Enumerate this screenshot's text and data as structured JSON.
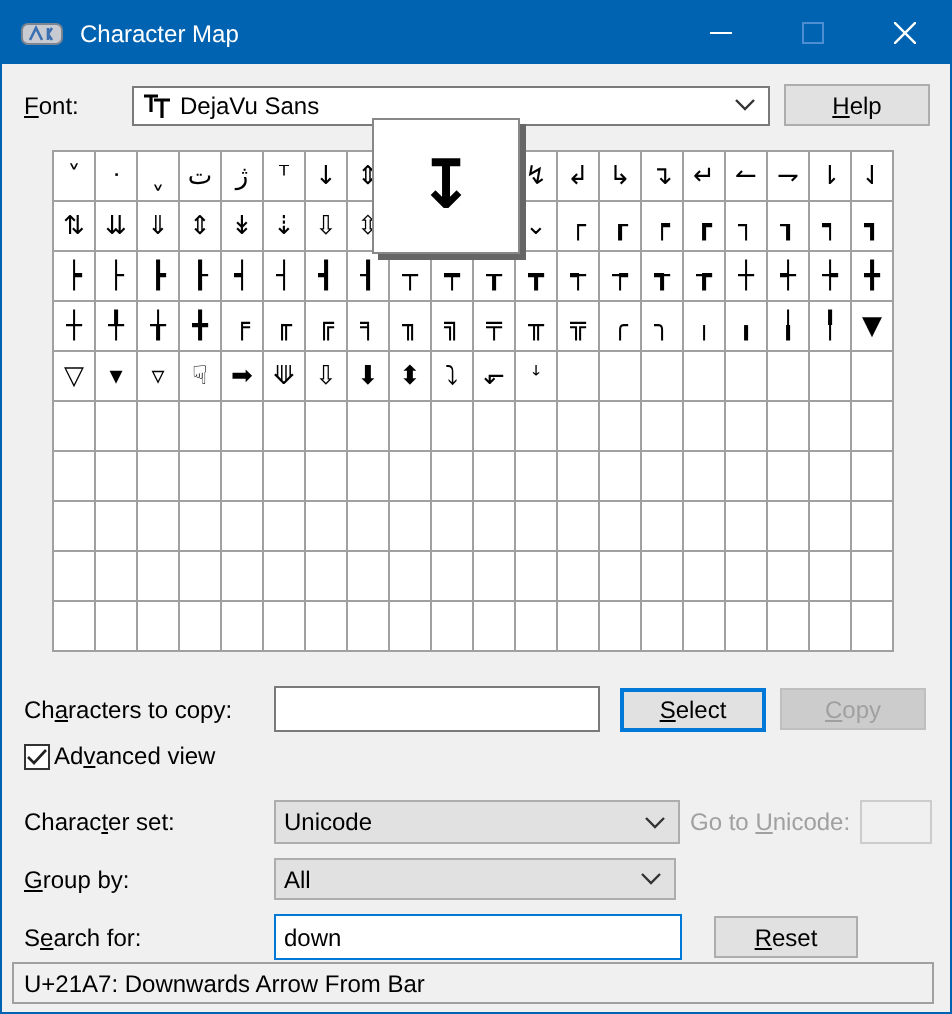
{
  "window": {
    "title": "Character Map"
  },
  "font": {
    "label": {
      "key": "F",
      "post": "ont:"
    },
    "value": "DejaVu Sans"
  },
  "help_button": {
    "key": "H",
    "post": "elp"
  },
  "grid": [
    {
      "cells": [
        "˅",
        "ᐧ",
        "ˬ",
        "ت",
        "ژ",
        "ᵀ",
        "↓",
        "⇕"
      ],
      "after_magnifier": [
        "↯",
        "↲",
        "↳",
        "↴",
        "↵",
        "↼",
        "⇁",
        "⇂",
        "⇃"
      ]
    },
    {
      "cells": [
        "⇅",
        "⇊",
        "⇓",
        "⇕",
        "↡",
        "⇣",
        "⇩",
        "⇳"
      ],
      "after_magnifier": [
        "⌄",
        "┌",
        "┎",
        "┍",
        "┏",
        "┐",
        "┒",
        "┑",
        "┓"
      ]
    },
    {
      "cells": [
        "┝",
        "├",
        "┣",
        "┠",
        "┥",
        "┤",
        "┫",
        "┨",
        "┬",
        "┯",
        "┰",
        "┳",
        "┭",
        "┮",
        "┱",
        "┲",
        "┼",
        "┽",
        "┾",
        "╋"
      ]
    },
    {
      "cells": [
        "┼",
        "╀",
        "╁",
        "╋",
        "╒",
        "╓",
        "╔",
        "╕",
        "╖",
        "╗",
        "╤",
        "╥",
        "╦",
        "╭",
        "╮",
        "╷",
        "╻",
        "╽",
        "╿",
        "▼"
      ]
    },
    {
      "cells": [
        "▽",
        "▾",
        "▿",
        "☟",
        "➡",
        "⟱",
        "⇩",
        "⬇",
        "⬍",
        "⤵",
        "⬐",
        "ꜜ"
      ]
    }
  ],
  "magnified": "↧",
  "copy_row": {
    "label": {
      "pre": "Ch",
      "key": "a",
      "post": "racters to copy:"
    }
  },
  "select_button": {
    "key": "S",
    "post": "elect"
  },
  "copy_button": {
    "key": "C",
    "post": "opy",
    "disabled": true
  },
  "advanced_view": {
    "label": {
      "pre": "Ad",
      "key": "v",
      "post": "anced view"
    },
    "checked": true
  },
  "character_set": {
    "label": {
      "pre": "Charac",
      "key": "t",
      "post": "er set:"
    },
    "value": "Unicode"
  },
  "go_to_unicode": {
    "label": {
      "pre": "Go to ",
      "key": "U",
      "post": "nicode:"
    },
    "disabled": true
  },
  "group_by": {
    "label": {
      "key": "G",
      "post": "roup by:"
    },
    "value": "All"
  },
  "search": {
    "label": {
      "pre": "S",
      "key": "e",
      "post": "arch for:"
    },
    "value": "down"
  },
  "reset_button": {
    "key": "R",
    "post": "eset"
  },
  "status_bar": "U+21A7: Downwards Arrow From Bar"
}
